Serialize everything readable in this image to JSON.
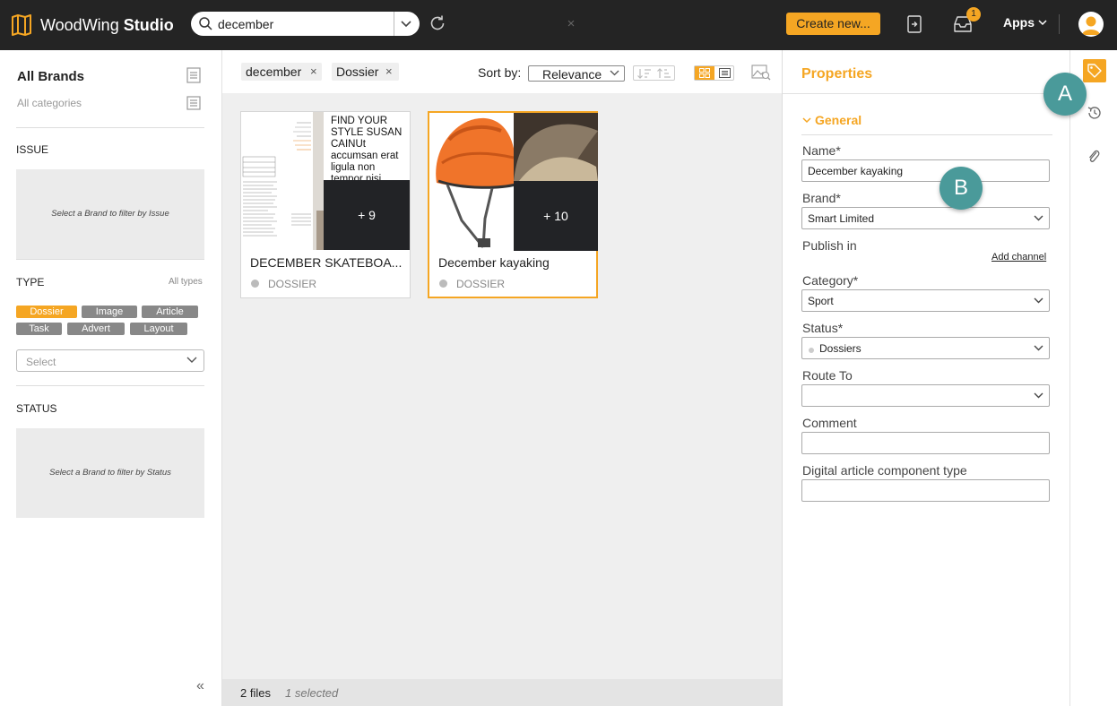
{
  "app": {
    "name_light": "WoodWing ",
    "name_bold": "Studio"
  },
  "search": {
    "value": "december",
    "clear": "×"
  },
  "topbar": {
    "create_label": "Create new...",
    "inbox_badge": "1",
    "apps_label": "Apps"
  },
  "sidebar": {
    "brand": "All Brands",
    "category": "All categories",
    "issue_title": "ISSUE",
    "issue_placeholder": "Select a Brand to filter by Issue",
    "type_title": "TYPE",
    "all_types": "All types",
    "types": [
      {
        "label": "Dossier",
        "active": true
      },
      {
        "label": "Image",
        "active": false
      },
      {
        "label": "Article",
        "active": false
      },
      {
        "label": "Task",
        "active": false
      },
      {
        "label": "Advert",
        "active": false
      },
      {
        "label": "Layout",
        "active": false
      }
    ],
    "type_select_placeholder": "Select",
    "status_title": "STATUS",
    "status_placeholder": "Select a Brand to filter by Status",
    "collapse": "«"
  },
  "filters": {
    "tags": [
      "december",
      "Dossier"
    ],
    "tag_remove": "×",
    "sort_label": "Sort by:",
    "sort_value": "Relevance"
  },
  "results": {
    "cards": [
      {
        "title": "DECEMBER SKATEBOA...",
        "type": "DOSSIER",
        "more": "+ 9",
        "preview_text": "FIND YOUR STYLE SUSAN CAINUt accumsan erat ligula non tempor nisi",
        "selected": false
      },
      {
        "title": "December kayaking",
        "type": "DOSSIER",
        "more": "+ 10",
        "selected": true
      }
    ],
    "file_count": "2 files",
    "selected_count": "1 selected"
  },
  "properties": {
    "title": "Properties",
    "section": "General",
    "name_label": "Name*",
    "name_value": "December kayaking",
    "brand_label": "Brand*",
    "brand_value": "Smart Limited",
    "publish_label": "Publish in",
    "add_channel": "Add channel",
    "category_label": "Category*",
    "category_value": "Sport",
    "status_label": "Status*",
    "status_value": "Dossiers",
    "route_label": "Route To",
    "route_value": "",
    "comment_label": "Comment",
    "comment_value": "",
    "digital_label": "Digital article component type",
    "digital_value": ""
  },
  "callouts": {
    "a": "A",
    "b": "B"
  },
  "colors": {
    "accent": "#f5a623",
    "topbar": "#242424",
    "callout": "#4a9a9a"
  },
  "icons": [
    "logo-map-icon",
    "search-icon",
    "refresh-icon",
    "check-out-icon",
    "inbox-icon",
    "tag-icon",
    "history-icon",
    "paperclip-icon"
  ]
}
